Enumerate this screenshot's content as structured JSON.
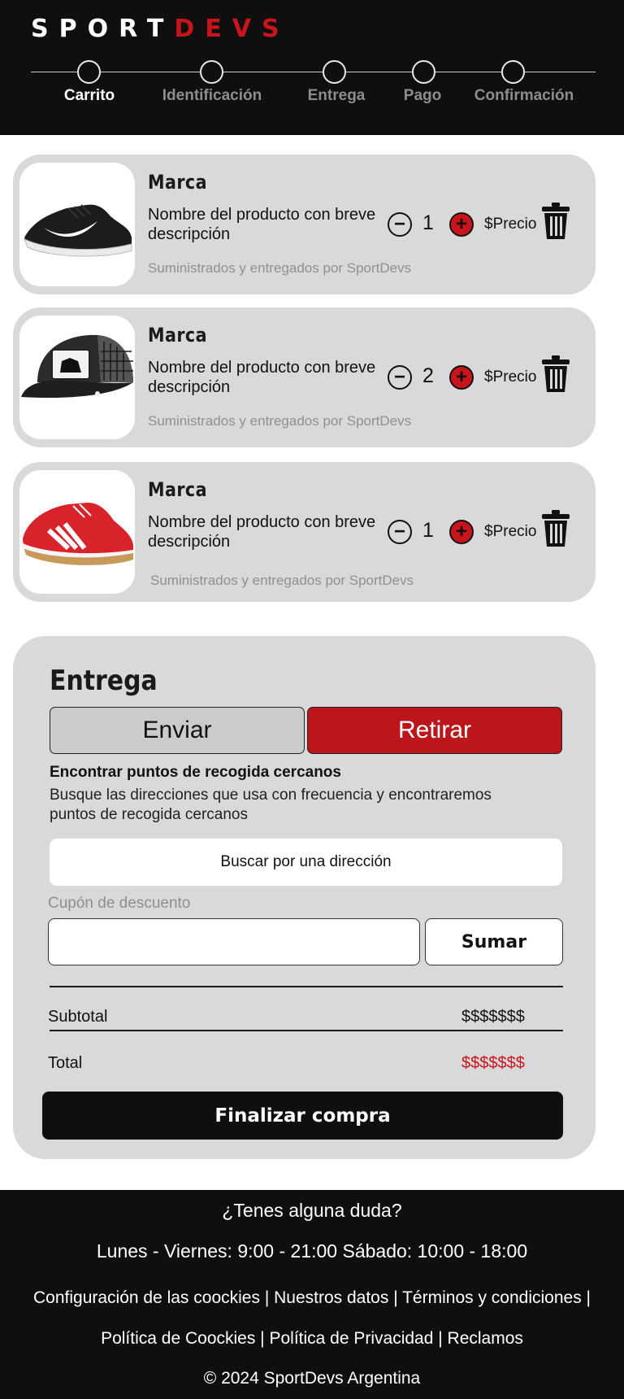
{
  "brand": {
    "name_part1": "SPORT",
    "name_part2": "DEVS"
  },
  "steps": [
    {
      "label": "Carrito",
      "active": true
    },
    {
      "label": "Identificación",
      "active": false
    },
    {
      "label": "Entrega",
      "active": false
    },
    {
      "label": "Pago",
      "active": false
    },
    {
      "label": "Confirmación",
      "active": false
    }
  ],
  "products": [
    {
      "brand": "Marca",
      "name": "Nombre del producto con breve descripción",
      "quantity": "1",
      "price": "$Precio",
      "supplier": "Suministrados y entregados por SportDevs",
      "image": "black-sneaker"
    },
    {
      "brand": "Marca",
      "name": "Nombre del producto con breve descripción",
      "quantity": "2",
      "price": "$Precio",
      "supplier": "Suministrados y entregados por SportDevs",
      "image": "black-trucker-cap"
    },
    {
      "brand": "Marca",
      "name": "Nombre del producto con breve descripción",
      "quantity": "1",
      "price": "$Precio",
      "supplier": "Suministrados y entregados por SportDevs",
      "image": "red-sneaker"
    }
  ],
  "summary": {
    "title": "Entrega",
    "option_send": "Enviar",
    "option_pickup": "Retirar",
    "selected_option": "Retirar",
    "pickup_heading": "Encontrar puntos de recogida cercanos",
    "pickup_description": "Busque las direcciones que usa con frecuencia y encontraremos puntos de recogida cercanos",
    "search_label": "Buscar por una dirección",
    "coupon_label": "Cupón de descuento",
    "coupon_value": "",
    "coupon_button": "Sumar",
    "subtotal_label": "Subtotal",
    "subtotal_value": "$$$$$$$",
    "total_label": "Total",
    "total_value": "$$$$$$$",
    "checkout_button": "Finalizar compra"
  },
  "footer": {
    "question": "¿Tenes alguna duda?",
    "hours": "Lunes - Viernes: 9:00 - 21:00 Sábado: 10:00 - 18:00",
    "links": [
      "Configuración de las coockies",
      "Nuestros datos",
      "Términos y condiciones",
      "Política de Coockies",
      "Política de Privacidad",
      "Reclamos"
    ],
    "copyright": "©  2024  SportDevs Argentina"
  },
  "colors": {
    "accent_red": "#c8141b",
    "header_bg": "#0f0f0f",
    "card_bg": "#d9d9d9"
  }
}
